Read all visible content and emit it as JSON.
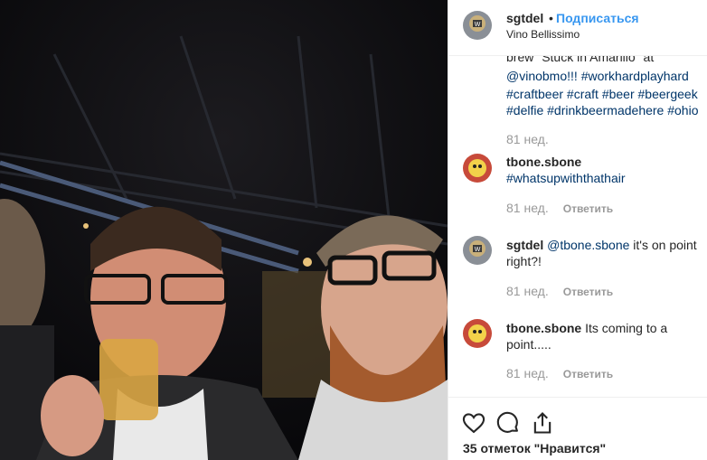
{
  "post": {
    "author": "sgtdel",
    "follow_label": "Подписаться",
    "location": "Vino Bellissimo",
    "separator": "•"
  },
  "caption": {
    "line1": "brew \"Stuck in Amarillo\" at",
    "mention": "@vinobmo!!!",
    "tags_line2": "#workhardplayhard",
    "tags_line3": "#craftbeer #craft #beer #beergeek",
    "tags_line4": "#delfie #drinkbeermadehere #ohio",
    "time": "81 нед."
  },
  "comments": [
    {
      "user": "tbone.sbone",
      "text": "#whatsupwiththathair",
      "time": "81 нед.",
      "reply": "Ответить"
    },
    {
      "user": "sgtdel",
      "mention": "@tbone.sbone",
      "text": " it's on point",
      "text2": "right?!",
      "time": "81 нед.",
      "reply": "Ответить"
    },
    {
      "user": "tbone.sbone",
      "text": " Its coming to a",
      "text2": "point.....",
      "time": "81 нед.",
      "reply": "Ответить"
    }
  ],
  "actions": {
    "like_icon": "heart-icon",
    "comment_icon": "comment-icon",
    "share_icon": "share-icon",
    "likes_text": "35 отметок \"Нравится\""
  }
}
